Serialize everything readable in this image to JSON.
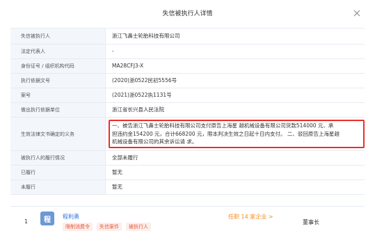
{
  "dialog": {
    "title": "失信被执行人详情",
    "close_icon": "close-icon"
  },
  "rows": [
    {
      "label": "失信被执行人",
      "value": "浙江飞鼻士轮胎科技有限公司"
    },
    {
      "label": "法定代表人",
      "value": "-"
    },
    {
      "label": "身份证号 / 组织机构代码",
      "value": "MA28CFJ3-X"
    },
    {
      "label": "执行依据文号",
      "value": "(2020)浙0522民初5556号"
    },
    {
      "label": "案号",
      "value": "(2021)浙0522执1131号"
    },
    {
      "label": "做出执行依据单位",
      "value": "浙江省长兴县人民法院"
    }
  ],
  "duty": {
    "label": "生效法律文书确定的义务",
    "lines": [
      "一、被告浙江飞鼻士轮胎科技有限公司支付原告上海星 越机械设备有限公司货款514000 元、承",
      "担违约金154200 元，合计668200 元，限本判决生效之日起十日内支付。 二、驳回原告上海星越",
      "机械设备有限公司的其余诉讼请 求。"
    ]
  },
  "rows_after": [
    {
      "label": "被执行人的履行情况",
      "value": "全部未履行"
    },
    {
      "label": "已履行",
      "value": "暂无"
    },
    {
      "label": "未履行",
      "value": "暂无"
    }
  ],
  "person": {
    "index": "1",
    "avatar_char": "程",
    "name": "程利勇",
    "tags": [
      "限制消费令",
      "失信案件",
      "被执行人"
    ],
    "job_link": "任职 14 家企业 >",
    "role": "董事长"
  }
}
